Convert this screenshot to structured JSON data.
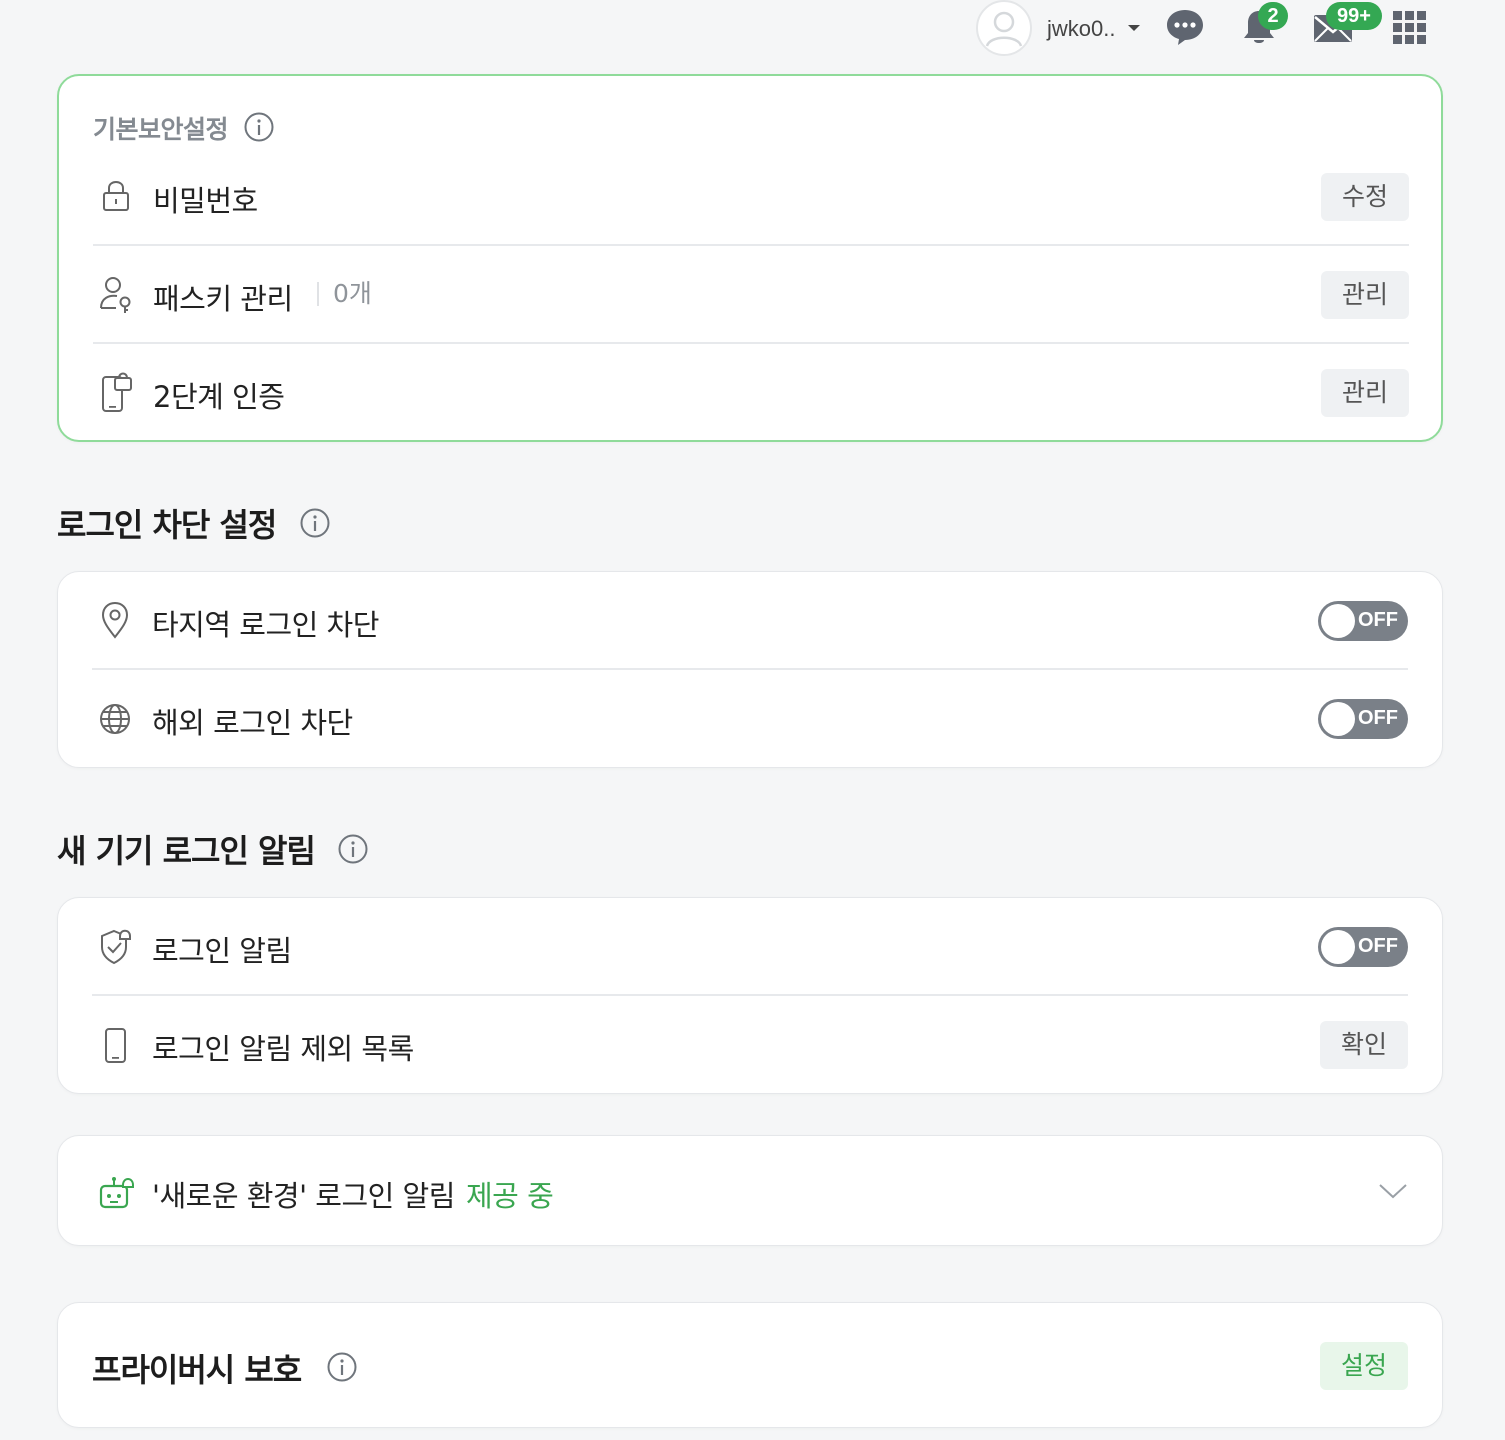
{
  "header": {
    "username": "jwko0..",
    "notification_count": "2",
    "mail_count": "99+"
  },
  "basic_security": {
    "title": "기본보안설정",
    "items": [
      {
        "label": "비밀번호",
        "button": "수정"
      },
      {
        "label": "패스키 관리",
        "sub": "0개",
        "button": "관리"
      },
      {
        "label": "2단계 인증",
        "button": "관리"
      }
    ]
  },
  "login_block": {
    "title": "로그인 차단 설정",
    "items": [
      {
        "label": "타지역 로그인 차단",
        "toggle": "OFF"
      },
      {
        "label": "해외 로그인 차단",
        "toggle": "OFF"
      }
    ]
  },
  "new_device": {
    "title": "새 기기 로그인 알림",
    "items": [
      {
        "label": "로그인 알림",
        "toggle": "OFF"
      },
      {
        "label": "로그인 알림 제외 목록",
        "button": "확인"
      }
    ]
  },
  "new_env": {
    "label": "'새로운 환경' 로그인 알림",
    "status": "제공 중"
  },
  "privacy": {
    "title": "프라이버시 보호",
    "button": "설정"
  },
  "colors": {
    "accent_green": "#3aa650",
    "card_border_green": "#8fdb9a",
    "toggle_off": "#7a8088",
    "badge_green": "#34a853"
  }
}
